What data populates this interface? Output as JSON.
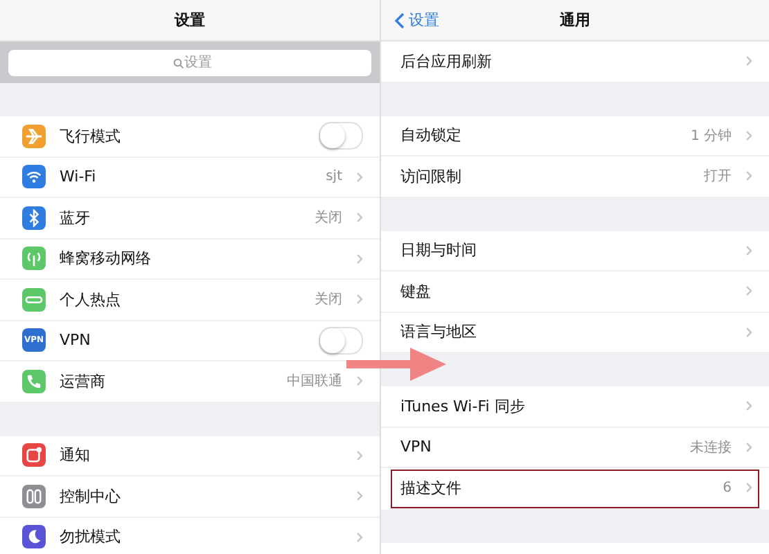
{
  "left": {
    "title": "设置",
    "search": {
      "placeholder": "设置"
    },
    "groups": [
      [
        {
          "kind": "toggle",
          "label": "飞行模式",
          "on": false,
          "color": "#f0a030"
        },
        {
          "kind": "link",
          "label": "Wi-Fi",
          "value": "sjt",
          "color": "#2f7de1"
        },
        {
          "kind": "link",
          "label": "蓝牙",
          "value": "关闭",
          "color": "#2f7de1"
        },
        {
          "kind": "link",
          "label": "蜂窝移动网络",
          "color": "#5cc86a"
        },
        {
          "kind": "link",
          "label": "个人热点",
          "value": "关闭",
          "color": "#5cc86a"
        },
        {
          "kind": "toggle",
          "label": "VPN",
          "on": false,
          "color": "#2f6fd0",
          "badge": "VPN"
        },
        {
          "kind": "link",
          "label": "运营商",
          "value": "中国联通",
          "color": "#5cc86a"
        }
      ],
      [
        {
          "kind": "link",
          "label": "通知",
          "color": "#e84545"
        },
        {
          "kind": "link",
          "label": "控制中心",
          "color": "#8e8e93"
        },
        {
          "kind": "link",
          "label": "勿扰模式",
          "color": "#5a55d6"
        }
      ]
    ]
  },
  "right": {
    "back": "设置",
    "title": "通用",
    "groups": [
      [
        {
          "kind": "link",
          "label": "后台应用刷新",
          "highlighted": false
        }
      ],
      [
        {
          "kind": "link",
          "label": "自动锁定",
          "value": "1 分钟",
          "highlighted": false
        },
        {
          "kind": "link",
          "label": "访问限制",
          "value": "打开",
          "highlighted": false
        }
      ],
      [
        {
          "kind": "link",
          "label": "日期与时间",
          "highlighted": false
        },
        {
          "kind": "link",
          "label": "键盘",
          "highlighted": false
        },
        {
          "kind": "link",
          "label": "语言与地区",
          "highlighted": false
        }
      ],
      [
        {
          "kind": "link",
          "label": "iTunes Wi-Fi 同步",
          "highlighted": false
        },
        {
          "kind": "link",
          "label": "VPN",
          "value": "未连接",
          "highlighted": false
        },
        {
          "kind": "link",
          "label": "描述文件",
          "value": "6",
          "highlighted": true
        }
      ]
    ]
  }
}
